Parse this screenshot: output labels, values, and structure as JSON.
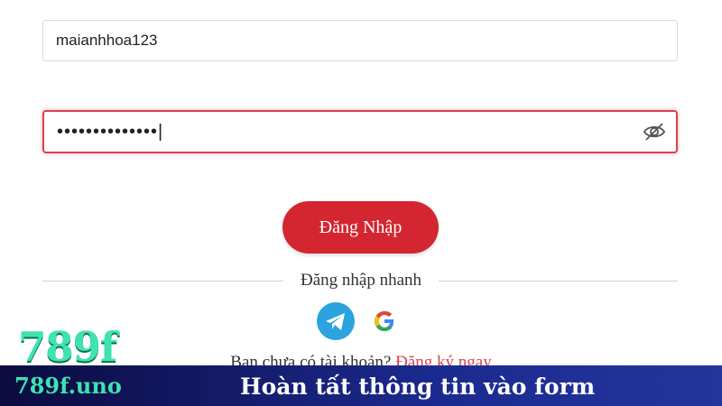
{
  "login_form": {
    "username_value": "maianhhoa123",
    "password_value": "••••••••••••••|",
    "login_button_label": "Đăng Nhập",
    "quick_login_label": "Đăng nhập nhanh",
    "signup_prompt": "Bạn chưa có tài khoản?",
    "signup_link_label": "Đăng ký ngay",
    "social_icons": [
      "telegram-icon",
      "google-icon"
    ],
    "icons": {
      "password_toggle": "eye-slash-icon"
    }
  },
  "banner": {
    "logo_text": "789f",
    "logo_domain": "789f.uno",
    "title": "Hoàn tất thông tin vào form"
  },
  "colors": {
    "accent_red": "#d32630",
    "error_border": "#d9434e",
    "telegram_blue": "#2aa3de",
    "banner_dark": "#0b0b3f",
    "banner_blue": "#23359c",
    "logo_green": "#3ee3b0"
  }
}
